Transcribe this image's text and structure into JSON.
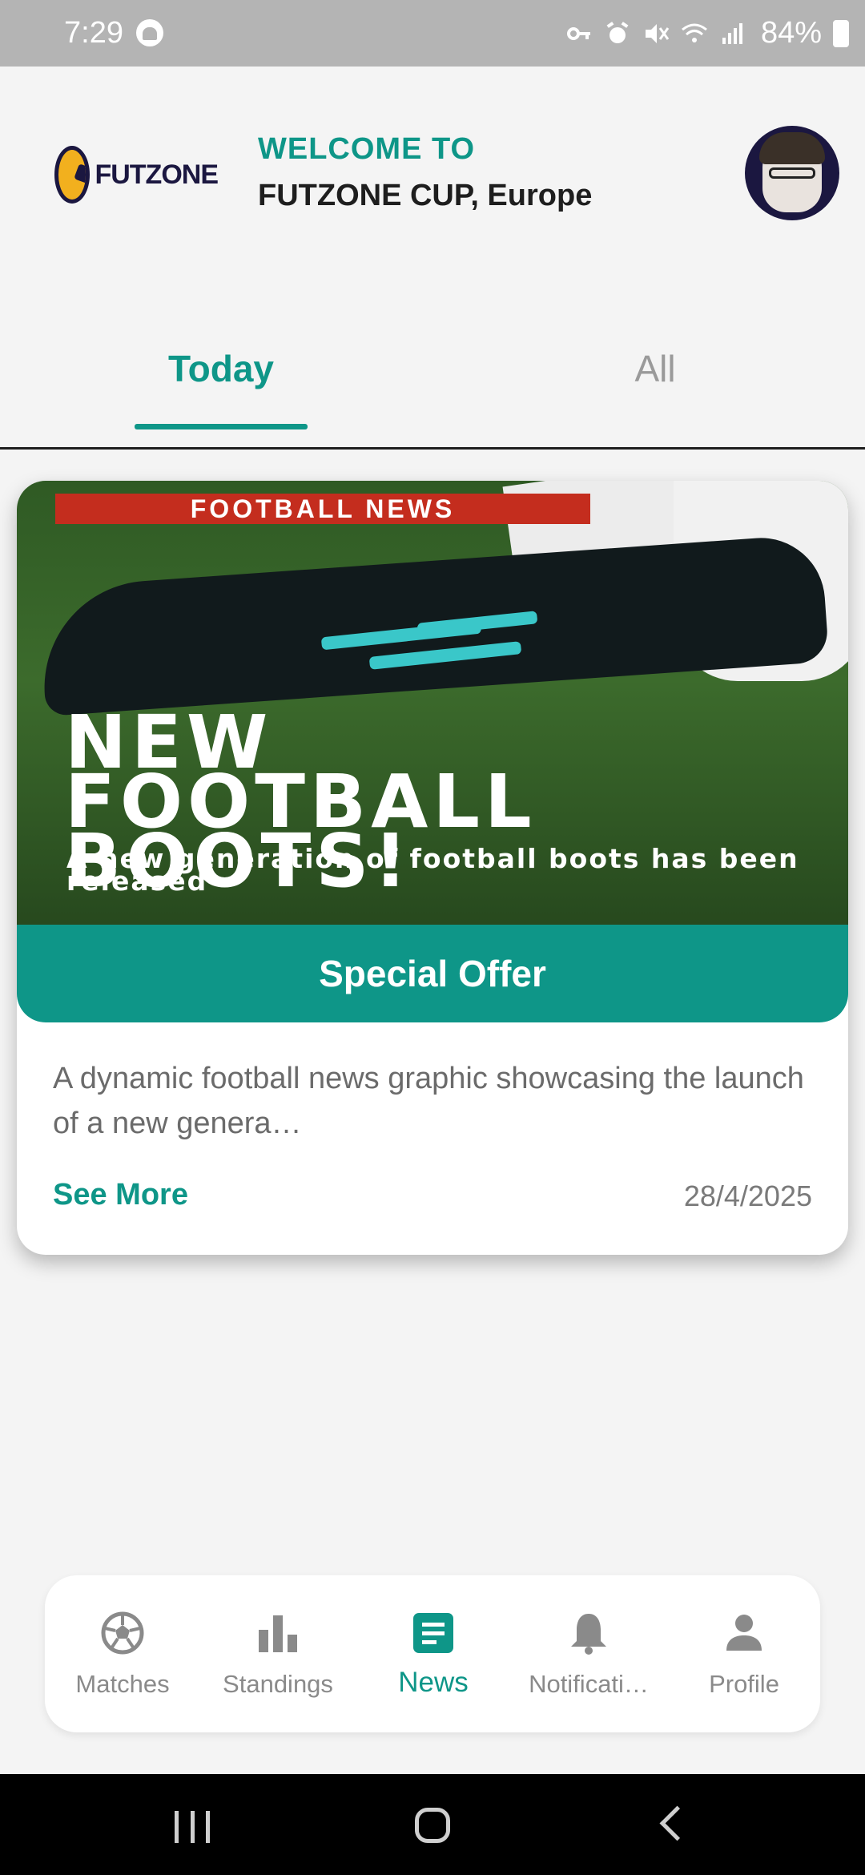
{
  "status_bar": {
    "time": "7:29",
    "battery": "84%"
  },
  "header": {
    "logo_text": "FUTZONE",
    "welcome": "WELCOME TO",
    "event_name": "FUTZONE CUP, Europe"
  },
  "tabs": [
    {
      "label": "Today",
      "active": true
    },
    {
      "label": "All",
      "active": false
    }
  ],
  "news_card": {
    "image_banner": "FOOTBALL NEWS",
    "image_headline": [
      "NEW",
      "FOOTBALL",
      "BOOTS!"
    ],
    "image_subline": "A new generation of football boots has been released",
    "offer_label": "Special Offer",
    "description": "A dynamic football news graphic showcasing the launch of a new genera…",
    "see_more": "See More",
    "date": "28/4/2025"
  },
  "bottom_nav": [
    {
      "label": "Matches",
      "icon": "soccer-ball-icon",
      "active": false
    },
    {
      "label": "Standings",
      "icon": "bar-chart-icon",
      "active": false
    },
    {
      "label": "News",
      "icon": "news-icon",
      "active": true
    },
    {
      "label": "Notificati…",
      "icon": "bell-icon",
      "active": false
    },
    {
      "label": "Profile",
      "icon": "person-icon",
      "active": false
    }
  ],
  "colors": {
    "accent": "#0e9688",
    "banner_red": "#c42d1e",
    "logo_navy": "#1b1740"
  }
}
